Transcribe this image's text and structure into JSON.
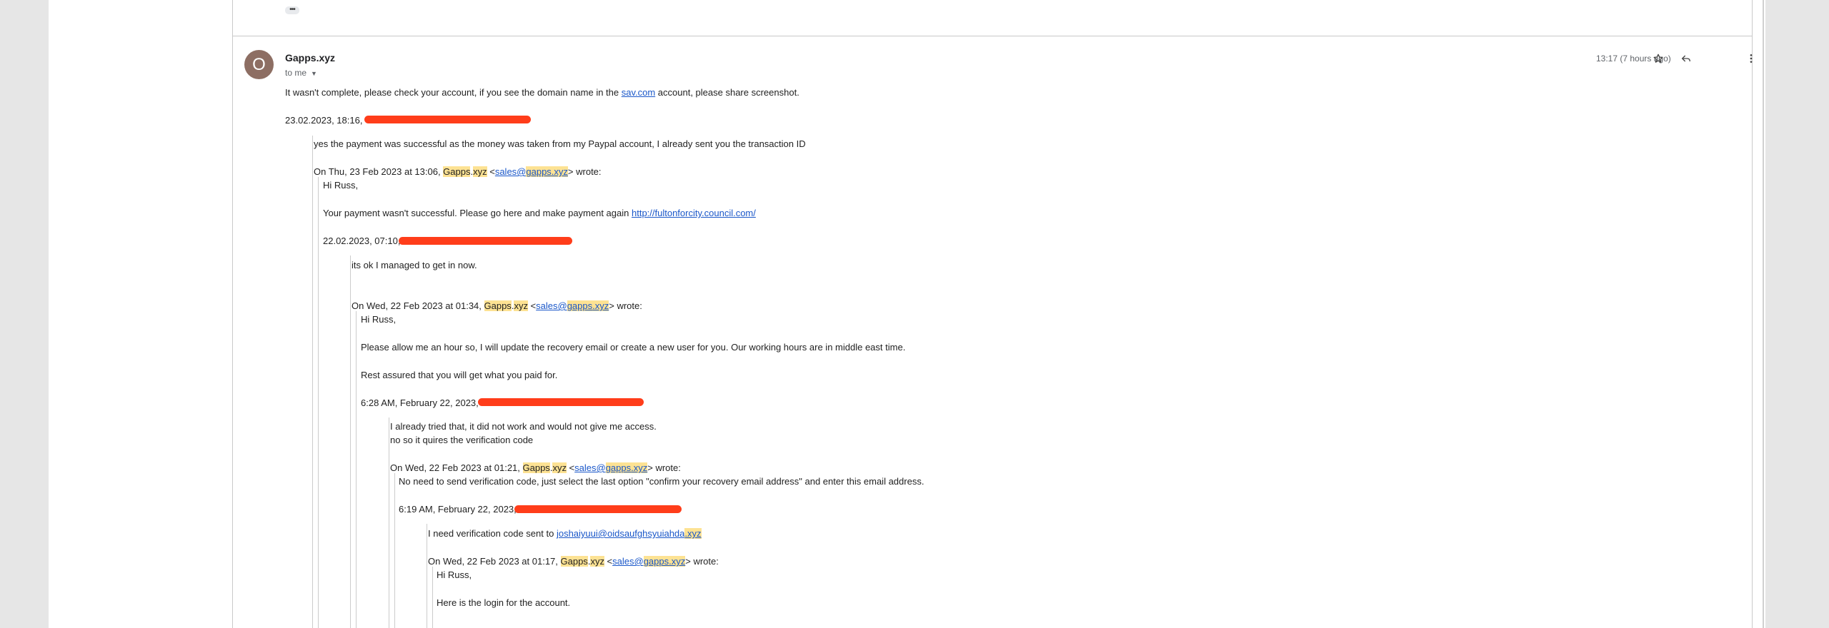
{
  "thread": {
    "more_dots": "•••",
    "avatar_letter": "O",
    "sender": "Gapps.xyz",
    "to_me": "to me",
    "time": "13:17 (7 hours ago)",
    "icons": [
      "star-icon",
      "reply-icon",
      "more-vert-icon"
    ]
  },
  "body": {
    "line1_pre": "It wasn't complete, please check your account, if you see the domain name in the ",
    "line1_link": "sav.com",
    "line1_post": " account, please share screenshot.",
    "q1_header": "23.02.2023, 18:16,",
    "q1_text": "yes the payment was successful as the money was taken from my Paypal account, I already sent you the transaction ID",
    "q2_header_pre": "On Thu, 23 Feb 2023 at 13:06, ",
    "gapps_a": "Gapps",
    "gapps_dot": ".",
    "gapps_b": "xyz",
    "lt": " <",
    "email_a": "sales@",
    "email_b": "gapps",
    "email_c": ".xyz",
    "wrote": "> wrote:",
    "hi_russ": "Hi Russ,",
    "q2_text_pre": "Your payment wasn't successful. Please go here and make payment again ",
    "q2_link": "http://fultonforcity.council.com/",
    "q3_header": "22.02.2023, 07:10,",
    "q3_text": "its ok I managed to get in now.",
    "q4_header_pre": "On Wed, 22 Feb 2023 at 01:34, ",
    "q4_text1": "Please allow me an hour so, I will update the recovery email or create a new user for you. Our working hours are in middle east time.",
    "q4_text2": "Rest assured that you will get what you paid for.",
    "q5_header": "6:28 AM, February 22, 2023,",
    "q5_text1": "I already tried that, it did not work and would not give me access.",
    "q5_text2": "no so it quires the verification code",
    "q6_header_pre": "On Wed, 22 Feb 2023 at 01:21, ",
    "q6_text": "No need to send verification code, just select the last option \"confirm your recovery email address\" and enter this email address.",
    "q7_header": "6:19 AM, February 22, 2023,",
    "q7_text_pre": "I need verification code sent to ",
    "q7_link_a": "joshaiyuui@oidsaufghsyuiahda",
    "q7_link_b": ".xyz",
    "q8_header_pre": "On Wed, 22 Feb 2023 at 01:17, ",
    "q8_text": "Here is the login for the account."
  }
}
